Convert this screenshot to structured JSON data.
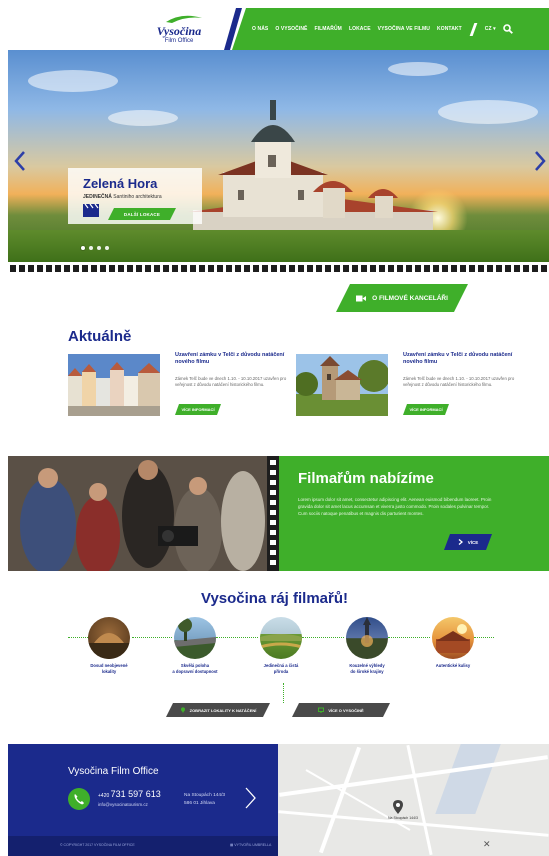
{
  "header": {
    "logo_brand": "Vysočina",
    "logo_sub": "Film Office",
    "nav": [
      "O NÁS",
      "O VYSOČINĚ",
      "FILMAŘŮM",
      "LOKACE",
      "VYSOČINA VE FILMU",
      "KONTAKT"
    ],
    "lang": "CZ ▾",
    "colors": {
      "green": "#3faf2a",
      "navy": "#1b2a8c"
    }
  },
  "hero": {
    "title": "Zelená Hora",
    "subtitle_bold": "JEDINEČNÁ",
    "subtitle_rest": " Santiniho architektura",
    "button": "DALŠÍ LOKACE"
  },
  "film_office_button": "O FILMOVÉ KANCELÁŘI",
  "news": {
    "title": "Aktuálně",
    "items": [
      {
        "headline": "Uzavření zámku v Telči z důvodu natáčení nového filmu",
        "text": "Zámek Telč bude ve dnech 1.10. - 10.10.2017 uzavřen pro veřejnost z důvodu natáčení historického filmu.",
        "button": "VÍCE INFORMACÍ"
      },
      {
        "headline": "Uzavření zámku v Telči z důvodu natáčení nového filmu",
        "text": "Zámek Telč bude ve dnech 1.10. - 10.10.2017 uzavřen pro veřejnost z důvodu natáčení historického filmu.",
        "button": "VÍCE INFORMACÍ"
      }
    ]
  },
  "offer": {
    "title": "Filmařům nabízíme",
    "text": "Lorem ipsum dolor sit amet, consectetur adipiscing elit. Aenean euismod bibendum laoreet. Proin gravida dolor sit amet lacus accumsan et viverra justo commodo. Proin sodales pulvinar tempor. Cum sociis natoque penatibus et magnis dis parturient montes.",
    "button": "VÍCE"
  },
  "paradise": {
    "title": "Vysočina ráj filmařů!",
    "items": [
      {
        "label1": "Dosud neobjevené",
        "label2": "lokality"
      },
      {
        "label1": "Skvělá poloha",
        "label2": "a dopravní dostupnost"
      },
      {
        "label1": "Jedinečná a čistá",
        "label2": "příroda"
      },
      {
        "label1": "Kouzelné výhledy",
        "label2": "do široké krajiny"
      },
      {
        "label1": "Autentické kulisy",
        "label2": ""
      }
    ],
    "btn_locations": "ZOBRAZIT LOKALITY K NATÁČENÍ",
    "btn_about": "VÍCE O VYSOČINĚ"
  },
  "footer": {
    "title": "Vysočina Film Office",
    "phone_prefix": "+420 ",
    "phone": "731 597 613",
    "email": "info@vysocinatourism.cz",
    "addr1": "Na Stoupách 144/3",
    "addr2": "586 01 Jihlava",
    "copyright": "© COPYRIGHT 2017 VYSOČINA FILM OFFICE",
    "credit": "VYTVOŘIL UMBRELLA"
  },
  "map": {
    "pin_label": "Na Stoupách 144/3"
  }
}
